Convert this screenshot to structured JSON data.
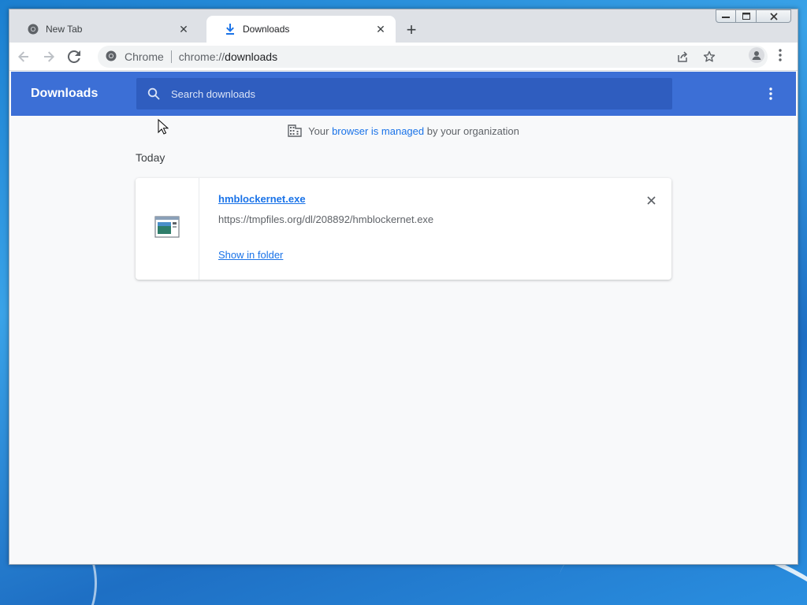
{
  "tabs": [
    {
      "title": "New Tab",
      "icon": "chrome-icon",
      "active": false
    },
    {
      "title": "Downloads",
      "icon": "download-icon",
      "active": true
    }
  ],
  "toolbar": {
    "site_name": "Chrome",
    "url_scheme": "chrome://",
    "url_path": "downloads"
  },
  "downloads": {
    "title": "Downloads",
    "search_placeholder": "Search downloads",
    "managed_prefix": "Your ",
    "managed_link": "browser is managed",
    "managed_suffix": " by your organization",
    "section_date": "Today",
    "items": [
      {
        "file_name": "hmblockernet.exe",
        "url": "https://tmpfiles.org/dl/208892/hmblockernet.exe",
        "action": "Show in folder"
      }
    ]
  },
  "colors": {
    "header_blue": "#3c6fd6",
    "search_blue": "#2f5dbf",
    "link_blue": "#1a73e8"
  }
}
